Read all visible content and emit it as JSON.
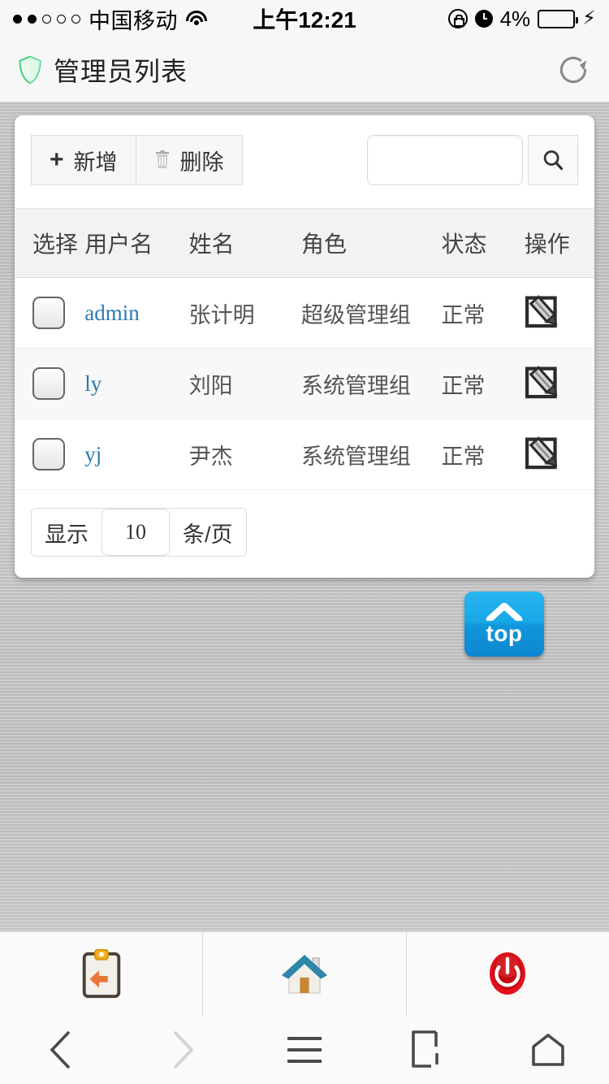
{
  "statusbar": {
    "signal_dots_filled": 2,
    "signal_dots_total": 5,
    "carrier": "中国移动",
    "wifi_icon": "wifi-icon",
    "time": "上午12:21",
    "rotation_lock_icon": "rotation-lock-icon",
    "alarm_icon": "alarm-clock-icon",
    "battery_percent": "4%",
    "battery_level": 4,
    "charging_icon": "lightning-bolt-icon"
  },
  "header": {
    "shield_icon": "shield-icon",
    "title": "管理员列表",
    "refresh_icon": "refresh-icon",
    "shield_color": "#3fd07a"
  },
  "toolbar": {
    "add_label": "新增",
    "add_icon": "plus-icon",
    "delete_label": "删除",
    "delete_icon": "trash-icon",
    "search_value": "",
    "search_placeholder": "",
    "search_icon": "search-icon"
  },
  "table": {
    "columns": [
      "选择",
      "用户名",
      "姓名",
      "角色",
      "状态",
      "操作"
    ],
    "rows": [
      {
        "username": "admin",
        "name": "张计明",
        "role": "超级管理组",
        "status": "正常",
        "action_icon": "edit-icon",
        "checked": false
      },
      {
        "username": "ly",
        "name": "刘阳",
        "role": "系统管理组",
        "status": "正常",
        "action_icon": "edit-icon",
        "checked": false
      },
      {
        "username": "yj",
        "name": "尹杰",
        "role": "系统管理组",
        "status": "正常",
        "action_icon": "edit-icon",
        "checked": false
      }
    ]
  },
  "pagination": {
    "prefix": "显示",
    "page_size": "10",
    "suffix": "条/页"
  },
  "scroll_top": {
    "label": "top",
    "icon": "chevron-up-icon",
    "color": "#18a8e8"
  },
  "app_toolbar": {
    "items": [
      {
        "icon": "clipboard-back-icon",
        "name": "back-to-list"
      },
      {
        "icon": "home-icon",
        "name": "home"
      },
      {
        "icon": "power-icon",
        "name": "logout"
      }
    ]
  },
  "nav_bar": {
    "items": [
      {
        "icon": "chevron-left-icon",
        "name": "browser-back",
        "enabled": true
      },
      {
        "icon": "chevron-right-icon",
        "name": "browser-forward",
        "enabled": false
      },
      {
        "icon": "hamburger-menu-icon",
        "name": "browser-menu",
        "enabled": true
      },
      {
        "icon": "tabs-icon",
        "name": "browser-tabs",
        "enabled": true
      },
      {
        "icon": "home-outline-icon",
        "name": "browser-home",
        "enabled": true
      }
    ]
  },
  "colors": {
    "link": "#2a7ab0",
    "header_bg": "#f2f2f2",
    "page_bg": "#c2c2c2"
  }
}
